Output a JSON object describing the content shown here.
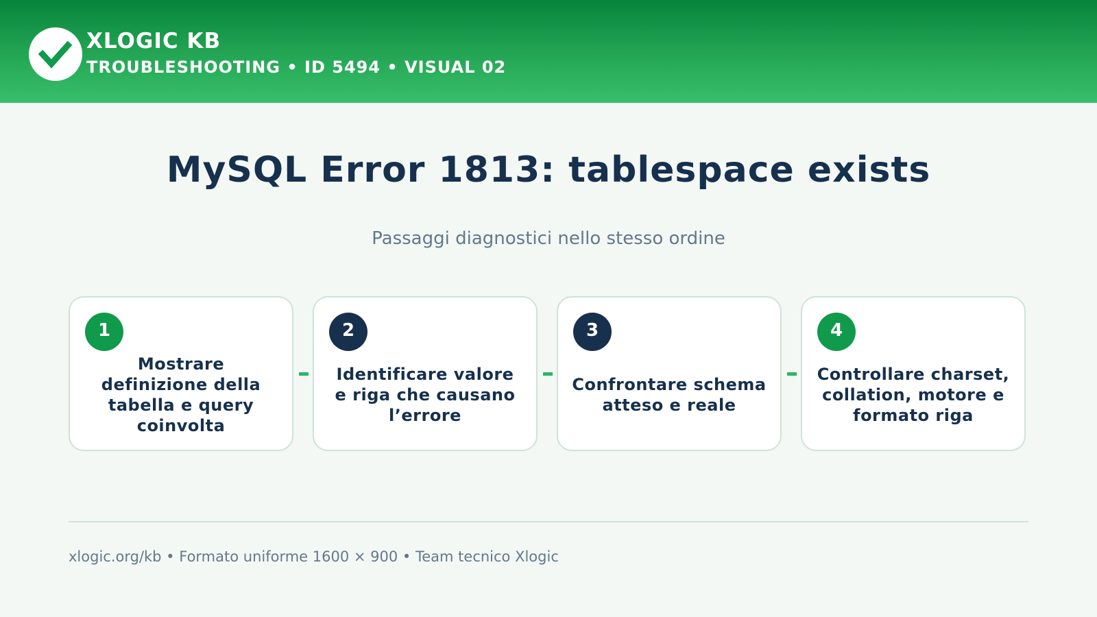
{
  "header": {
    "brand": "XLOGIC KB",
    "subtitle": "TROUBLESHOOTING • ID 5494 • VISUAL 02",
    "logo_icon": "check-icon"
  },
  "title": "MySQL Error 1813: tablespace exists",
  "subtitle": "Passaggi diagnostici nello stesso ordine",
  "steps": [
    {
      "number": "1",
      "text": "Mostrare definizione della tabella e query coinvolta",
      "badge_color": "#0f9a4c"
    },
    {
      "number": "2",
      "text": "Identificare valore e riga che causano l’errore",
      "badge_color": "#17304e"
    },
    {
      "number": "3",
      "text": "Confrontare schema atteso e reale",
      "badge_color": "#17304e"
    },
    {
      "number": "4",
      "text": "Controllare charset, collation, motore e formato riga",
      "badge_color": "#0f9a4c"
    }
  ],
  "footer": "xlogic.org/kb • Formato uniforme 1600 × 900 • Team tecnico Xlogic",
  "colors": {
    "header_green": "#22a452",
    "accent_green": "#2db36a",
    "navy": "#16304d",
    "muted": "#64788a"
  }
}
